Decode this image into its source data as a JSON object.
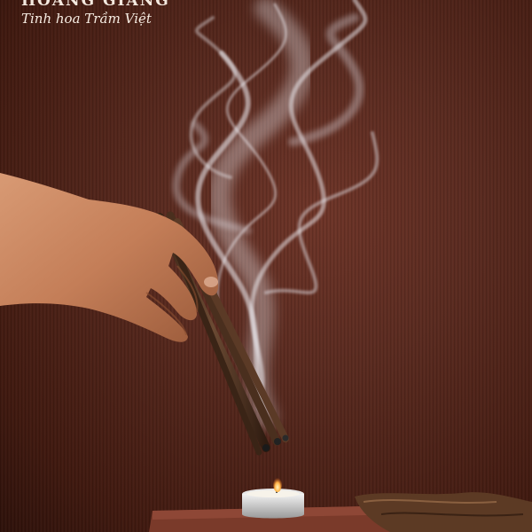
{
  "brand": {
    "name": "HOÀNG GIANG",
    "tagline": "Tinh hoa Trầm Việt"
  }
}
